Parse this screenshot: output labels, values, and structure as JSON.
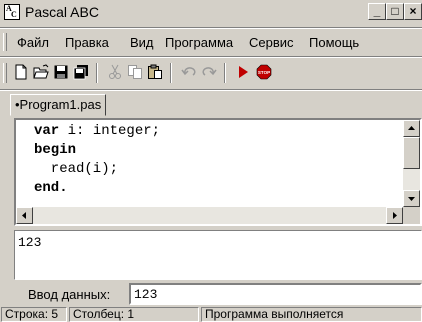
{
  "window": {
    "title": "Pascal ABC",
    "buttons": {
      "minimize": "_",
      "maximize": "□",
      "close": "×"
    }
  },
  "menu": {
    "items": [
      "Файл",
      "Правка",
      "Вид",
      "Программа",
      "Сервис",
      "Помощь"
    ]
  },
  "toolbar": {
    "icons": [
      "new-file-icon",
      "open-folder-icon",
      "save-icon",
      "save-all-icon",
      "cut-icon",
      "copy-icon",
      "paste-icon",
      "undo-icon",
      "redo-icon",
      "run-icon",
      "stop-icon"
    ]
  },
  "tabs": [
    {
      "label": "•Program1.pas",
      "active": true
    }
  ],
  "editor": {
    "lines": [
      {
        "kw": "var",
        "rest": " i: integer;"
      },
      {
        "kw": "begin",
        "rest": ""
      },
      {
        "kw": "",
        "rest": "  read(i);"
      },
      {
        "kw": "end.",
        "rest": ""
      }
    ]
  },
  "output": {
    "text": "123"
  },
  "input": {
    "label": "Ввод данных:",
    "value": "123"
  },
  "status": {
    "line": "Строка: 5",
    "column": "Столбец: 1",
    "state": "Программа выполняется"
  },
  "colors": {
    "face": "#d4d0c8",
    "shadow": "#808080",
    "highlight": "#ffffff",
    "stop_icon": "#c00000"
  }
}
